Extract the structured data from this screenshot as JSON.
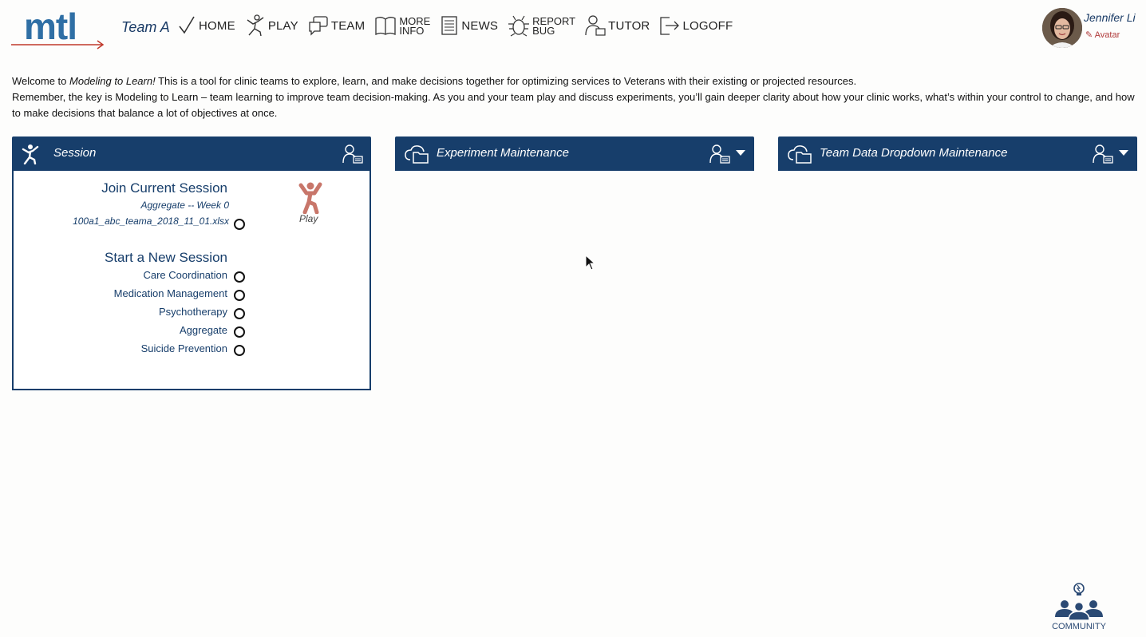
{
  "header": {
    "logo_text": "mtl",
    "team_name": "Team A",
    "nav": [
      {
        "label": "HOME",
        "icon": "check-icon"
      },
      {
        "label": "PLAY",
        "icon": "runner-icon"
      },
      {
        "label": "TEAM",
        "icon": "chat-icon"
      },
      {
        "label_line1": "MORE",
        "label_line2": "INFO",
        "icon": "book-icon"
      },
      {
        "label": "NEWS",
        "icon": "newspaper-icon"
      },
      {
        "label_line1": "REPORT",
        "label_line2": "BUG",
        "icon": "bug-icon"
      },
      {
        "label": "TUTOR",
        "icon": "tutor-icon"
      },
      {
        "label": "LOGOFF",
        "icon": "logoff-icon"
      }
    ],
    "user": {
      "name": "Jennifer Li",
      "avatar_link": "Avatar"
    }
  },
  "intro": {
    "line1_prefix": "Welcome to ",
    "line1_em": "Modeling to Learn!",
    "line1_rest": " This is a tool for clinic teams to explore, learn, and make decisions together for optimizing services to Veterans with their existing or projected resources.",
    "line2": "Remember, the key is Modeling to Learn – team learning to improve team decision-making. As you and your team play and discuss experiments, you’ll gain deeper clarity about how your clinic works, what’s within your control to change, and how to make decisions that balance a lot of objectives at once."
  },
  "panels": {
    "session": {
      "title": "Session",
      "join_title": "Join Current Session",
      "join_subtitle": "Aggregate -- Week 0",
      "join_file": "100a1_abc_teama_2018_11_01.xlsx",
      "play_label": "Play",
      "new_title": "Start a New Session",
      "options": [
        "Care Coordination",
        "Medication Management",
        "Psychotherapy",
        "Aggregate",
        "Suicide Prevention"
      ]
    },
    "experiment": {
      "title": "Experiment Maintenance"
    },
    "team_data": {
      "title": "Team Data Dropdown Maintenance"
    }
  },
  "community": {
    "label": "COMMUNITY"
  },
  "colors": {
    "panel_header": "#173e6b",
    "logo_blue": "#2f6fa5",
    "logo_arrow": "#c0392b",
    "play_figure": "#c8766a",
    "link": "#173e6b"
  }
}
